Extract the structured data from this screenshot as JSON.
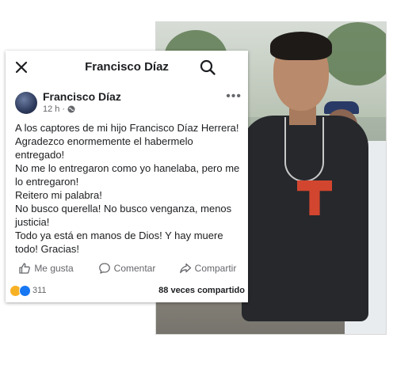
{
  "header": {
    "title": "Francisco Díaz",
    "close_icon": "close-icon",
    "search_icon": "search-icon"
  },
  "post": {
    "author": "Francisco Díaz",
    "time": "12 h",
    "separator": "·",
    "privacy_icon": "globe-icon",
    "lines": [
      "A los captores de mi hijo Francisco Díaz Herrera!",
      "Agradezco enormemente el habermelo",
      "entregado!",
      "No me lo entregaron como yo hanelaba, pero me",
      "lo entregaron!",
      "Reitero mi palabra!",
      "No busco querella! No busco venganza, menos",
      "justicia!",
      "Todo ya está en manos de Dios! Y hay muere",
      "todo! Gracias!"
    ]
  },
  "actions": {
    "like": "Me gusta",
    "comment": "Comentar",
    "share": "Compartir"
  },
  "stats": {
    "reactions_count": "311",
    "shares": "88 veces compartido"
  },
  "colors": {
    "text": "#1c1e21",
    "secondary": "#65676b",
    "like_blue": "#1877f2",
    "sad_yellow": "#f7b125"
  }
}
